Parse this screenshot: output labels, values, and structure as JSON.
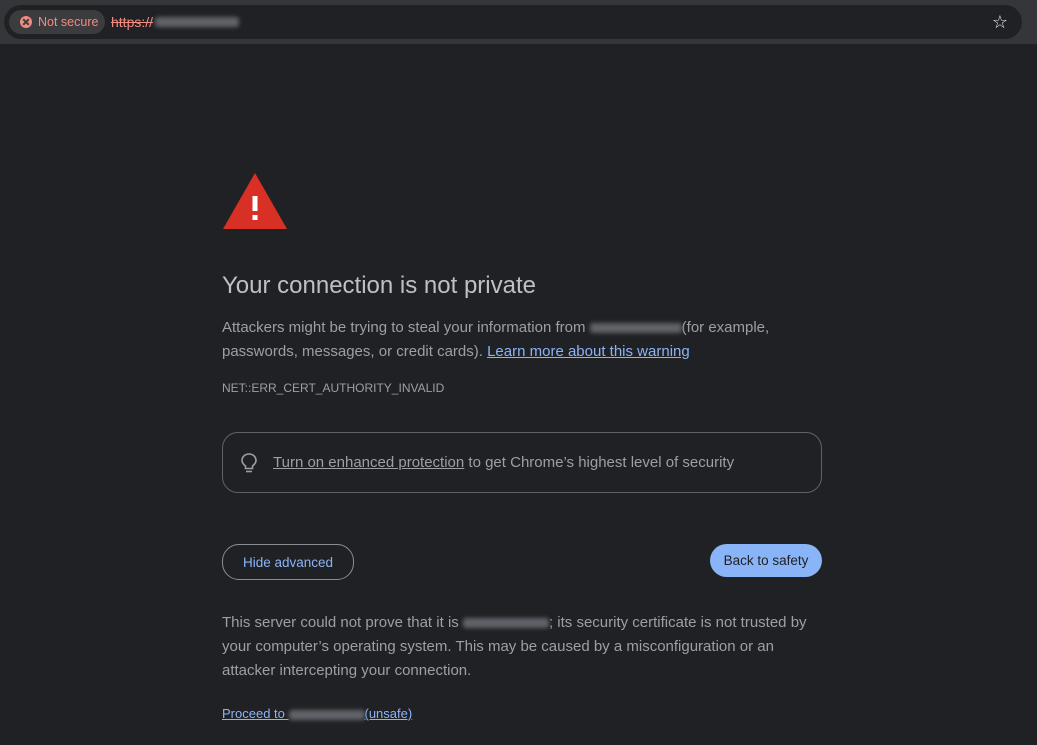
{
  "browser": {
    "security_chip": "Not secure",
    "url_scheme": "https://",
    "url_host_visible": "",
    "bookmark_icon": "star-outline-icon"
  },
  "interstitial": {
    "icon": "warning-triangle-icon",
    "title": "Your connection is not private",
    "para1_before": "Attackers might be trying to steal your information from ",
    "para1_after": "(for example, passwords, messages, or credit cards). ",
    "learn_more": "Learn more about this warning",
    "error_code": "NET::ERR_CERT_AUTHORITY_INVALID",
    "enhanced_link": "Turn on enhanced protection",
    "enhanced_rest": " to get Chrome’s highest level of security",
    "hide_advanced": "Hide advanced",
    "back_to_safety": "Back to safety",
    "para2_before": "This server could not prove that it is ",
    "para2_after": "; its security certificate is not trusted by your computer’s operating system. This may be caused by a misconfiguration or an attacker intercepting your connection.",
    "proceed_before": "Proceed to ",
    "proceed_after": "(unsafe)"
  },
  "colors": {
    "background": "#202124",
    "danger": "#f28b82",
    "link": "#8ab4f8",
    "warning_triangle": "#d93025"
  }
}
